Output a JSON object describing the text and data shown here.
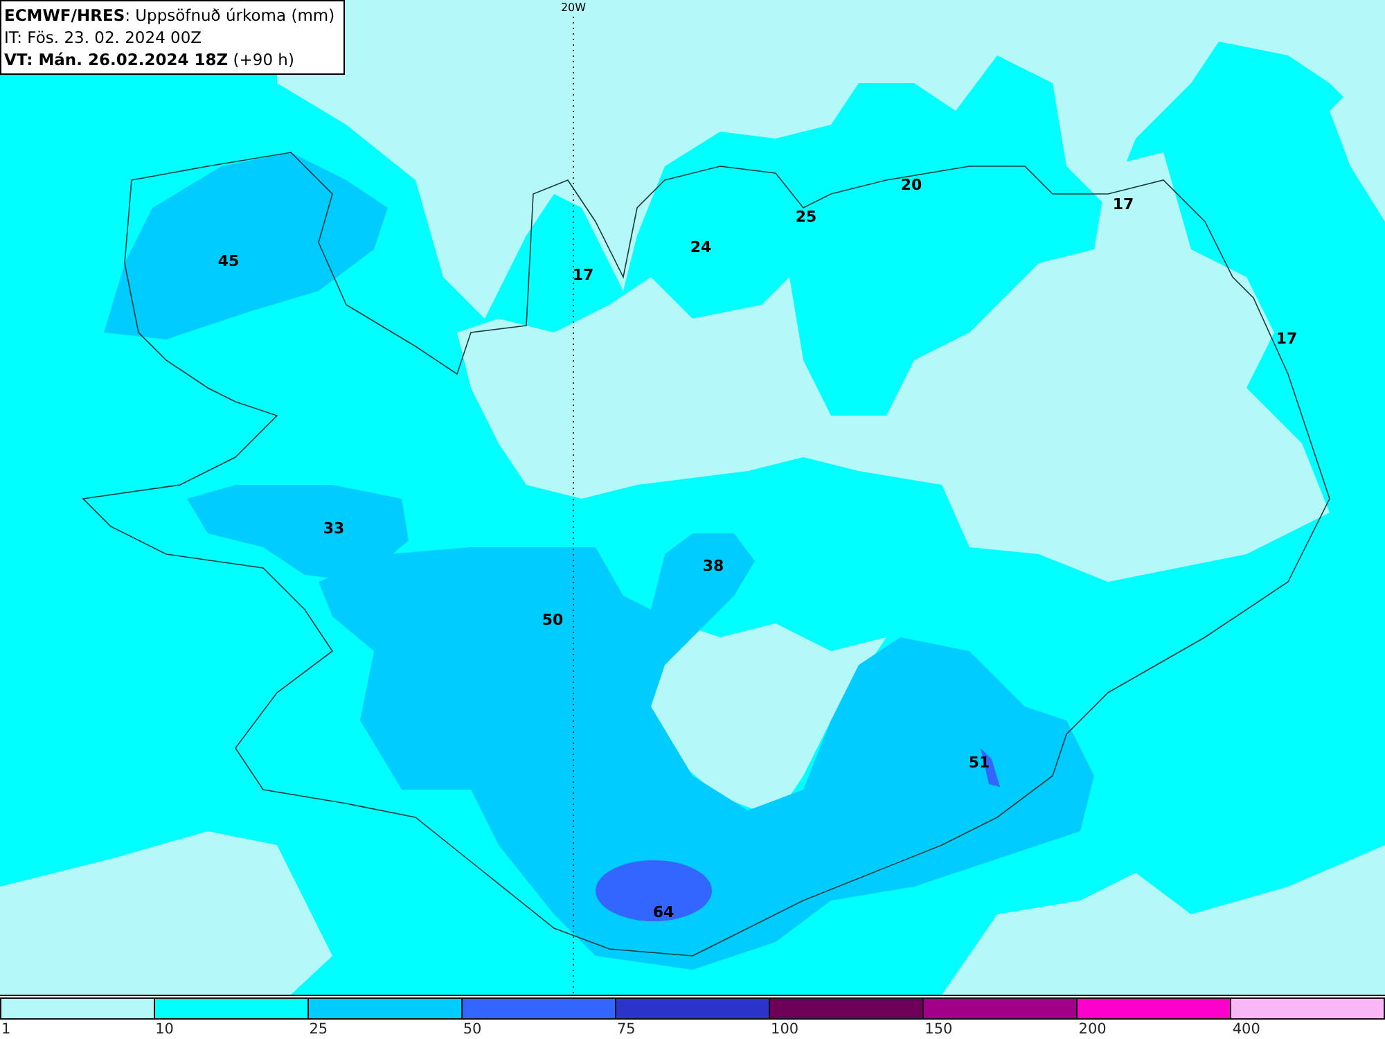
{
  "header": {
    "lines": [
      "**ECMWF/HRES**: Uppsöfnuð úrkoma (mm)",
      "IT: Fös. 23. 02. 2024 00Z",
      "**VT: Mán. 26.02.2024 18Z** (+90 h)"
    ]
  },
  "map": {
    "meridian_label": "20W",
    "value_labels": [
      "45",
      "17",
      "24",
      "25",
      "20",
      "17",
      "17",
      "33",
      "38",
      "50",
      "51",
      "64"
    ]
  },
  "legend": {
    "bins": [
      {
        "color": "#b4f8fa"
      },
      {
        "color": "#00ffff"
      },
      {
        "color": "#00ccff"
      },
      {
        "color": "#3366ff"
      },
      {
        "color": "#2b33c8"
      },
      {
        "color": "#6e0059"
      },
      {
        "color": "#a3008a"
      },
      {
        "color": "#ff00cc"
      },
      {
        "color": "#f9b8f5"
      }
    ],
    "ticks": [
      "1",
      "10",
      "25",
      "50",
      "75",
      "100",
      "150",
      "200",
      "400"
    ]
  }
}
